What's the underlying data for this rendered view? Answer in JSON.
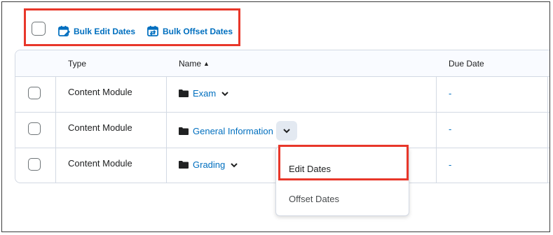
{
  "toolbar": {
    "bulk_edit_label": "Bulk Edit Dates",
    "bulk_offset_label": "Bulk Offset Dates"
  },
  "table": {
    "columns": [
      "Type",
      "Name",
      "Due Date"
    ],
    "sort_indicator": "▲",
    "rows": [
      {
        "type": "Content Module",
        "name": "Exam",
        "due": "-"
      },
      {
        "type": "Content Module",
        "name": "General Information",
        "due": "-"
      },
      {
        "type": "Content Module",
        "name": "Grading",
        "due": "-"
      }
    ]
  },
  "menu": {
    "items": [
      "Edit Dates",
      "Offset Dates"
    ]
  },
  "colors": {
    "link": "#006fbf",
    "highlight": "#e8372a"
  }
}
